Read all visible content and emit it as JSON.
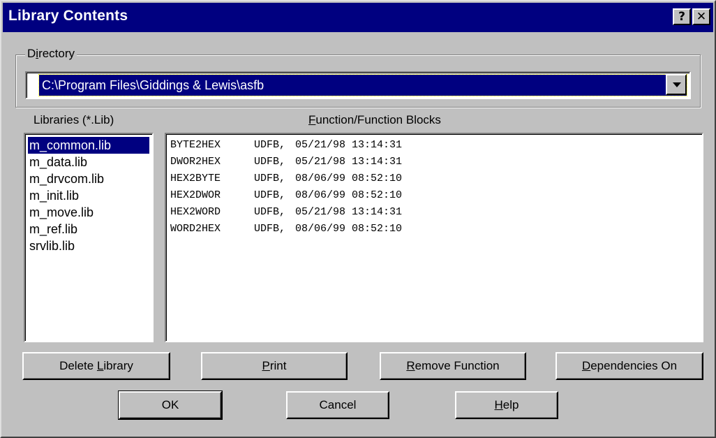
{
  "window": {
    "title": "Library Contents",
    "help_glyph": "?",
    "close_glyph": "✕"
  },
  "directory": {
    "label_pre": "D",
    "label_mnemonic": "i",
    "label_post": "rectory",
    "value": "C:\\Program Files\\Giddings & Lewis\\asfb"
  },
  "libraries": {
    "label": "Libraries (*.Lib)",
    "items": [
      "m_common.lib",
      "m_data.lib",
      "m_drvcom.lib",
      "m_init.lib",
      "m_move.lib",
      "m_ref.lib",
      "srvlib.lib"
    ],
    "selected": "m_common.lib"
  },
  "functions": {
    "label_mnemonic": "F",
    "label_post": "unction/Function Blocks",
    "rows": [
      {
        "name": "BYTE2HEX",
        "type": "UDFB,",
        "date": "05/21/98",
        "time": "13:14:31"
      },
      {
        "name": "DWOR2HEX",
        "type": "UDFB,",
        "date": "05/21/98",
        "time": "13:14:31"
      },
      {
        "name": "HEX2BYTE",
        "type": "UDFB,",
        "date": "08/06/99",
        "time": "08:52:10"
      },
      {
        "name": "HEX2DWOR",
        "type": "UDFB,",
        "date": "08/06/99",
        "time": "08:52:10"
      },
      {
        "name": "HEX2WORD",
        "type": "UDFB,",
        "date": "05/21/98",
        "time": "13:14:31"
      },
      {
        "name": "WORD2HEX",
        "type": "UDFB,",
        "date": "08/06/99",
        "time": "08:52:10"
      }
    ]
  },
  "buttons": {
    "delete_library": {
      "pre": "Delete ",
      "mnemonic": "L",
      "post": "ibrary"
    },
    "print": {
      "pre": "",
      "mnemonic": "P",
      "post": "rint"
    },
    "remove_function": {
      "pre": "",
      "mnemonic": "R",
      "post": "emove Function"
    },
    "dependencies_on": {
      "pre": "",
      "mnemonic": "D",
      "post": "ependencies On"
    },
    "ok": "OK",
    "cancel": "Cancel",
    "help": {
      "pre": "",
      "mnemonic": "H",
      "post": "elp"
    }
  }
}
